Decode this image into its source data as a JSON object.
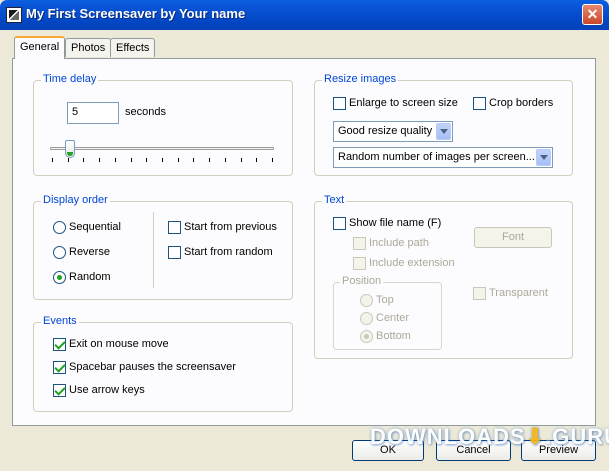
{
  "window": {
    "title": "My First Screensaver by Your name",
    "close_glyph": "✕"
  },
  "tabs": [
    {
      "label": "General",
      "active": true
    },
    {
      "label": "Photos",
      "active": false
    },
    {
      "label": "Effects",
      "active": false
    }
  ],
  "time_delay": {
    "group_label": "Time delay",
    "value": "5",
    "unit_label": "seconds",
    "slider_level": 0.08
  },
  "display_order": {
    "group_label": "Display order",
    "radios": [
      {
        "label": "Sequential",
        "selected": false
      },
      {
        "label": "Reverse",
        "selected": false
      },
      {
        "label": "Random",
        "selected": true
      }
    ],
    "checkboxes": [
      {
        "label": "Start from previous",
        "checked": false
      },
      {
        "label": "Start from random",
        "checked": false
      }
    ]
  },
  "events": {
    "group_label": "Events",
    "checkboxes": [
      {
        "label": "Exit on mouse move",
        "checked": true
      },
      {
        "label": "Spacebar pauses the screensaver",
        "checked": true
      },
      {
        "label": "Use arrow keys",
        "checked": true
      }
    ]
  },
  "resize_images": {
    "group_label": "Resize images",
    "enlarge_label": "Enlarge to screen size",
    "crop_label": "Crop borders",
    "quality_value": "Good resize quality",
    "images_value": "Random number of images per screen..."
  },
  "text": {
    "group_label": "Text",
    "show_file_name": "Show file name (F)",
    "include_path": "Include path",
    "include_extension": "Include extension",
    "font_button": "Font",
    "position_label": "Position",
    "positions": [
      {
        "label": "Top",
        "selected": false
      },
      {
        "label": "Center",
        "selected": false
      },
      {
        "label": "Bottom",
        "selected": true
      }
    ],
    "transparent_label": "Transparent"
  },
  "buttons": {
    "ok": "OK",
    "cancel": "Cancel",
    "preview": "Preview"
  },
  "watermark": {
    "text": "DOWNLOADS",
    "logo_glyph": "⬇",
    "suffix": ".GURU"
  }
}
